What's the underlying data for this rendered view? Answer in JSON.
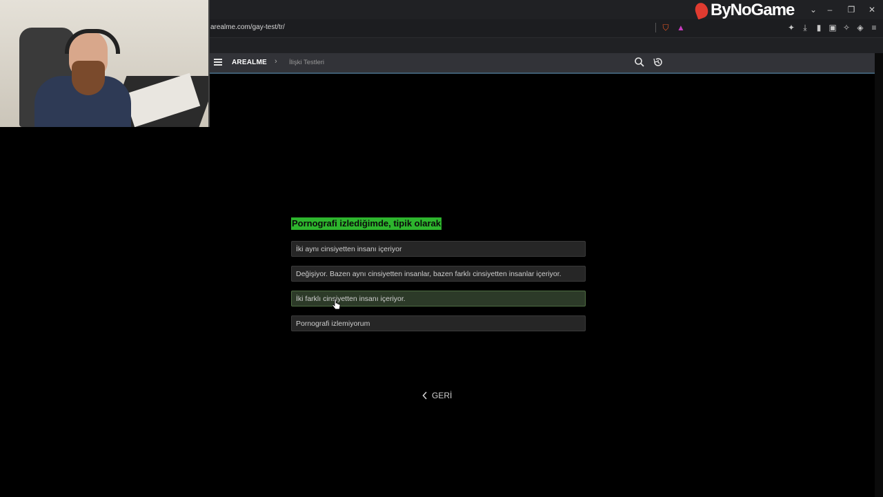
{
  "browser": {
    "url": "arealme.com/gay-test/tr/",
    "window_controls": [
      "minimize",
      "restore",
      "close"
    ]
  },
  "overlay": {
    "brand_logo_text": "ByNoGame"
  },
  "site": {
    "brand": "AREALME",
    "breadcrumb": "İlişki Testleri"
  },
  "quiz": {
    "question": "Pornografi izlediğimde, tipik olarak",
    "options": [
      "İki aynı cinsiyetten insanı içeriyor",
      "Değişiyor. Bazen aynı cinsiyetten insanlar, bazen farklı cinsiyetten insanlar içeriyor.",
      "İki farklı cinsiyetten insanı içeriyor.",
      "Pornografi izlemiyorum"
    ],
    "hovered_option_index": 2,
    "back_label": "GERİ"
  },
  "colors": {
    "question_highlight": "#2db52d",
    "navbar_bg": "#323338",
    "page_bg": "#000000"
  }
}
